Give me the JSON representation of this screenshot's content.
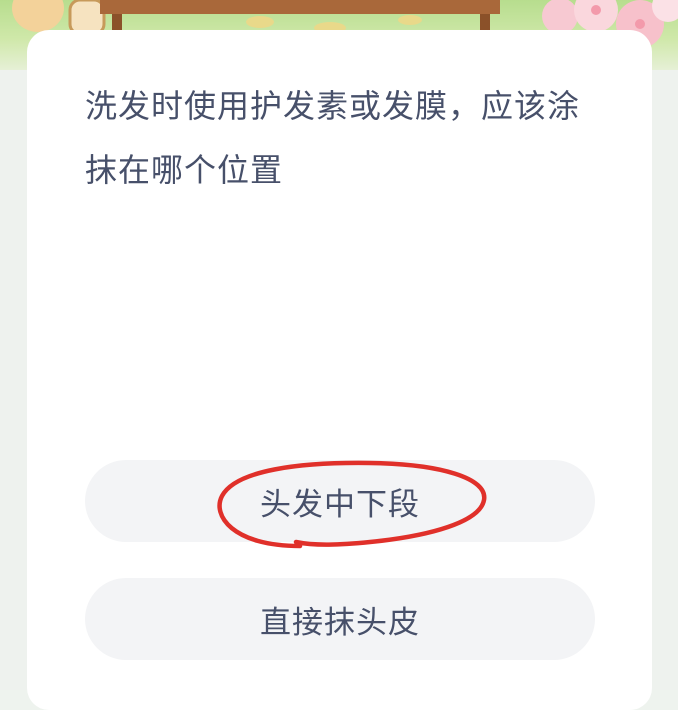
{
  "quiz": {
    "question": "洗发时使用护发素或发膜，应该涂抹在哪个位置",
    "options": [
      {
        "label": "头发中下段",
        "circled": true
      },
      {
        "label": "直接抹头皮",
        "circled": false
      }
    ]
  },
  "colors": {
    "text": "#47506a",
    "option_bg": "#f3f4f6",
    "card_bg": "#ffffff",
    "annotation_red": "#e0302a"
  }
}
